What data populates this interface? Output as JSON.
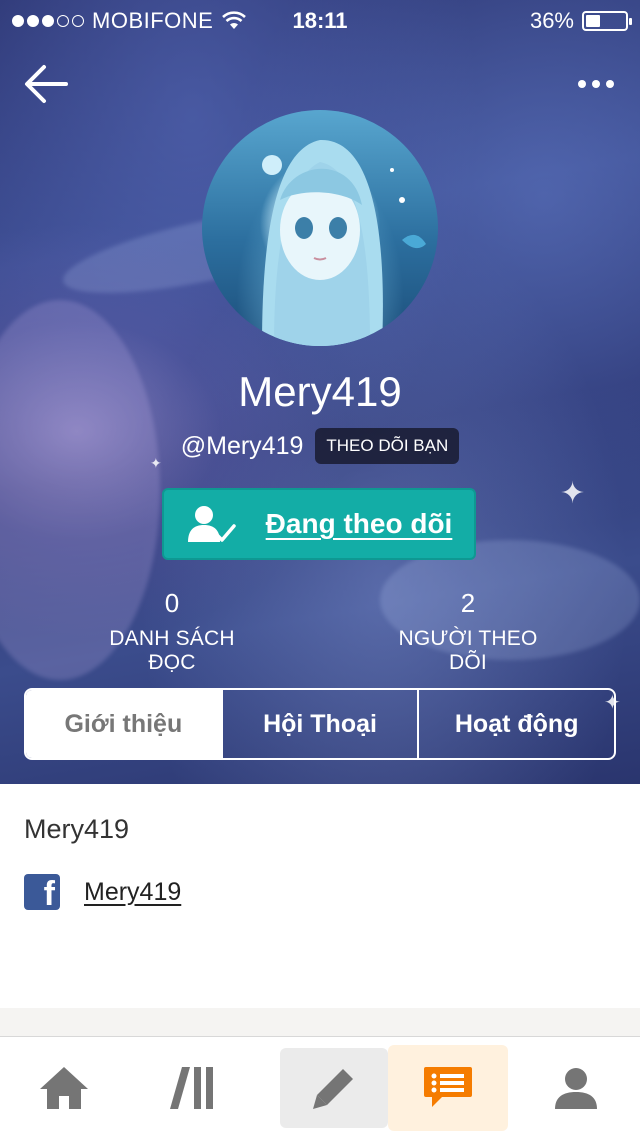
{
  "status_bar": {
    "carrier": "MOBIFONE",
    "signal_bars_filled": 3,
    "signal_bars_total": 5,
    "time": "18:11",
    "battery": "36%",
    "battery_level": 0.36
  },
  "nav": {
    "back_icon": "arrow-left-icon",
    "more_icon": "more-dots-icon"
  },
  "profile": {
    "display_name": "Mery419",
    "handle": "@Mery419",
    "follows_you_badge": "THEO DÕI BẠN",
    "follow_button_label": "Đang theo dõi",
    "follow_button_icon": "user-check-icon",
    "stats": [
      {
        "value": "0",
        "label": "DANH SÁCH ĐỌC"
      },
      {
        "value": "2",
        "label": "NGƯỜI THEO DÕI"
      }
    ]
  },
  "tabs": [
    {
      "label": "Giới thiệu",
      "active": true
    },
    {
      "label": "Hội Thoại",
      "active": false
    },
    {
      "label": "Hoạt động",
      "active": false
    }
  ],
  "about": {
    "name": "Mery419",
    "facebook_icon": "facebook-icon",
    "facebook_link": "Mery419"
  },
  "bottom_nav": [
    {
      "icon": "home-icon",
      "active": false
    },
    {
      "icon": "library-icon",
      "active": false
    },
    {
      "icon": "pencil-icon",
      "active": false
    },
    {
      "icon": "messages-icon",
      "active": true
    },
    {
      "icon": "profile-icon",
      "active": false
    }
  ],
  "colors": {
    "follow_button": "#13ada6",
    "active_nav_bg": "#fff1de",
    "active_nav_icon": "#f57c00",
    "inactive_nav_icon": "#757575",
    "facebook": "#3b5998"
  }
}
